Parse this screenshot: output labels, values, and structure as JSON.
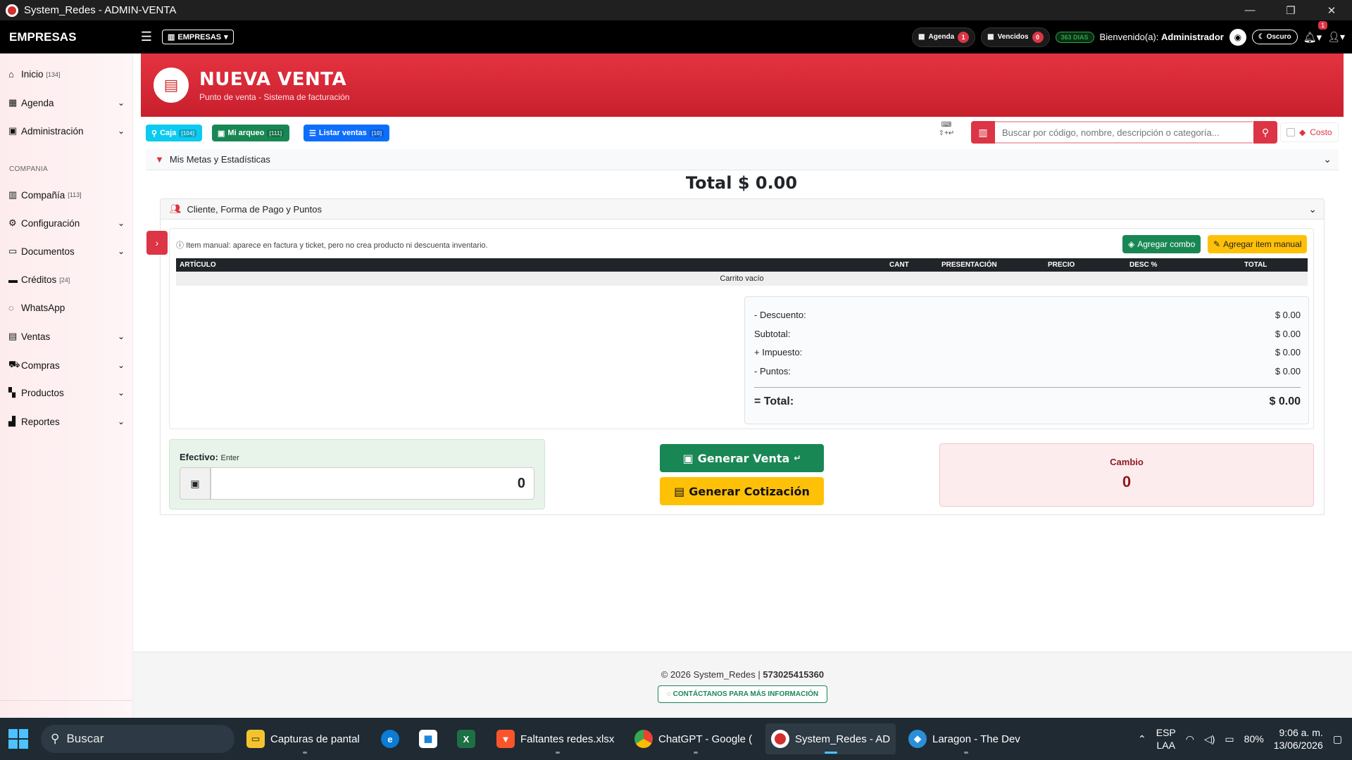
{
  "window": {
    "title": "System_Redes - ADMIN-VENTA",
    "controls": [
      "—",
      "❐",
      "✕"
    ]
  },
  "navbar": {
    "brand": "EMPRESAS",
    "empresas_btn": "EMPRESAS",
    "agenda_label": "Agenda",
    "agenda_count": "1",
    "vencidos_label": "Vencidos",
    "vencidos_count": "0",
    "days_badge": "363 DIAS",
    "welcome_prefix": "Bienvenido(a):",
    "welcome_user": "Administrador",
    "dark_mode": "Oscuro",
    "bell_count": "1"
  },
  "sidebar": {
    "items": [
      {
        "label": "Inicio",
        "sub": "[134]",
        "icon": "home-icon"
      },
      {
        "label": "Agenda",
        "icon": "calendar-icon"
      },
      {
        "label": "Administración",
        "icon": "admin-icon"
      },
      {
        "label": "Compañía",
        "sub": "[113]",
        "icon": "building-icon"
      },
      {
        "label": "Configuración",
        "icon": "cogs-icon"
      },
      {
        "label": "Documentos",
        "icon": "folder-icon"
      },
      {
        "label": "Créditos",
        "sub": "[24]",
        "icon": "card-icon"
      },
      {
        "label": "WhatsApp",
        "icon": "whatsapp-icon"
      },
      {
        "label": "Ventas",
        "icon": "cash-register-icon"
      },
      {
        "label": "Compras",
        "icon": "cart-icon"
      },
      {
        "label": "Productos",
        "icon": "boxes-icon"
      },
      {
        "label": "Reportes",
        "icon": "chart-icon"
      }
    ],
    "section": "COMPANIA"
  },
  "banner": {
    "title": "NUEVA VENTA",
    "subtitle": "Punto de venta - Sistema de facturación"
  },
  "toolbar": {
    "caja": "Caja",
    "caja_badge": "[104]",
    "arqueo": "Mi arqueo",
    "arqueo_badge": "[111]",
    "listar": "Listar ventas",
    "listar_badge": "[10]",
    "search_placeholder": "Buscar por código, nombre, descripción o categoría...",
    "costo": "Costo"
  },
  "metas": {
    "label": "Mis Metas y Estadísticas"
  },
  "total_display": "Total $ 0.00",
  "cliente": {
    "label": "Cliente, Forma de Pago y Puntos"
  },
  "cart": {
    "hint": "Item manual: aparece en factura y ticket, pero no crea producto ni descuenta inventario.",
    "combo_btn": "Agregar combo",
    "manual_btn": "Agregar item manual",
    "columns": [
      "ARTÍCULO",
      "CANT",
      "PRESENTACIÓN",
      "PRECIO",
      "DESC %",
      "TOTAL"
    ],
    "empty": "Carrito vacío"
  },
  "totals": {
    "descuento_label": "- Descuento:",
    "descuento": "$ 0.00",
    "subtotal_label": "Subtotal:",
    "subtotal": "$ 0.00",
    "impuesto_label": "+ Impuesto:",
    "impuesto": "$ 0.00",
    "puntos_label": "- Puntos:",
    "puntos": "$ 0.00",
    "total_label": "= Total:",
    "total": "$ 0.00"
  },
  "payment": {
    "efectivo_label": "Efectivo:",
    "efectivo_hint": "Enter",
    "efectivo_value": "0",
    "generar_venta": "Generar Venta",
    "generar_cotizacion": "Generar Cotización",
    "cambio_label": "Cambio",
    "cambio_value": "0"
  },
  "footer": {
    "copy": "© 2026 System_Redes |",
    "phone": "573025415360",
    "contact": "CONTÁCTANOS PARA MÁS INFORMACIÓN"
  },
  "taskbar": {
    "search": "Buscar",
    "apps": [
      {
        "label": "Capturas de pantal",
        "icon": "folder-icon"
      },
      {
        "label": "",
        "icon": "edge-icon"
      },
      {
        "label": "",
        "icon": "store-icon"
      },
      {
        "label": "",
        "icon": "excel-icon"
      },
      {
        "label": "Faltantes redes.xlsx",
        "icon": "brave-icon"
      },
      {
        "label": "ChatGPT - Google (",
        "icon": "chrome-icon"
      },
      {
        "label": "System_Redes - AD",
        "icon": "system-redes-icon"
      },
      {
        "label": "Laragon - The Dev",
        "icon": "laragon-icon"
      }
    ],
    "lang_top": "ESP",
    "lang_bottom": "LAA",
    "battery": "80%",
    "time": "9:06 a. m.",
    "date": "13/06/2026"
  },
  "colors": {
    "primary_red": "#dc3545",
    "success": "#198754",
    "warning": "#ffc107",
    "navbar": "#000000"
  }
}
